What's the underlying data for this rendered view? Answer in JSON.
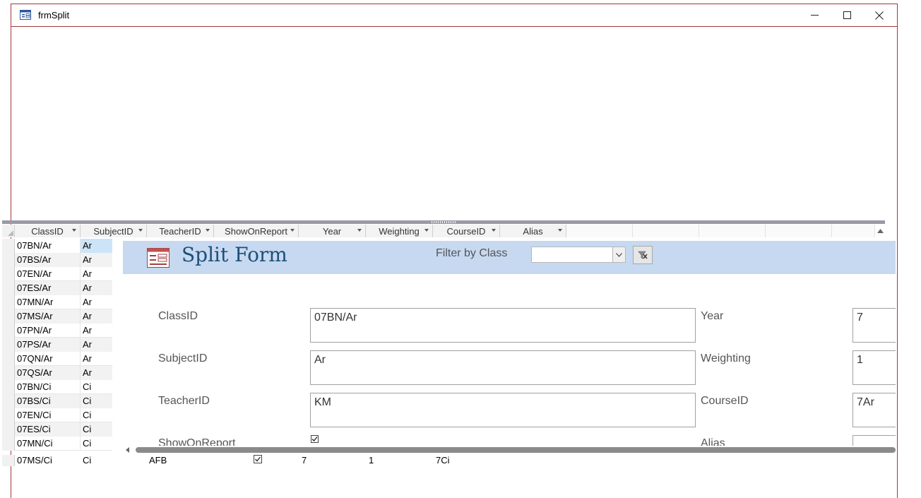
{
  "window": {
    "title": "frmSplit",
    "minimize_glyph": "—",
    "maximize_glyph": "☐",
    "close_glyph": "✕"
  },
  "datasheet": {
    "columns": [
      "ClassID",
      "SubjectID",
      "TeacherID",
      "ShowOnReport",
      "Year",
      "Weighting",
      "CourseID",
      "Alias"
    ],
    "rows": [
      {
        "ClassID": "07BN/Ar",
        "SubjectID": "Ar"
      },
      {
        "ClassID": "07BS/Ar",
        "SubjectID": "Ar"
      },
      {
        "ClassID": "07EN/Ar",
        "SubjectID": "Ar"
      },
      {
        "ClassID": "07ES/Ar",
        "SubjectID": "Ar"
      },
      {
        "ClassID": "07MN/Ar",
        "SubjectID": "Ar"
      },
      {
        "ClassID": "07MS/Ar",
        "SubjectID": "Ar"
      },
      {
        "ClassID": "07PN/Ar",
        "SubjectID": "Ar"
      },
      {
        "ClassID": "07PS/Ar",
        "SubjectID": "Ar"
      },
      {
        "ClassID": "07QN/Ar",
        "SubjectID": "Ar"
      },
      {
        "ClassID": "07QS/Ar",
        "SubjectID": "Ar"
      },
      {
        "ClassID": "07BN/Ci",
        "SubjectID": "Ci"
      },
      {
        "ClassID": "07BS/Ci",
        "SubjectID": "Ci"
      },
      {
        "ClassID": "07EN/Ci",
        "SubjectID": "Ci"
      },
      {
        "ClassID": "07ES/Ci",
        "SubjectID": "Ci"
      },
      {
        "ClassID": "07MN/Ci",
        "SubjectID": "Ci"
      }
    ],
    "partial_row": {
      "ClassID": "07MS/Ci",
      "SubjectID": "Ci",
      "TeacherID": "AFB",
      "Year": "7",
      "Weighting": "1",
      "CourseID": "7Ci"
    }
  },
  "form": {
    "title": "Split Form",
    "filter_label": "Filter by Class",
    "filter_value": "",
    "fields": {
      "classid_label": "ClassID",
      "classid_value": "07BN/Ar",
      "subjectid_label": "SubjectID",
      "subjectid_value": "Ar",
      "teacherid_label": "TeacherID",
      "teacherid_value": "KM",
      "showonreport_label": "ShowOnReport",
      "year_label": "Year",
      "year_value": "7",
      "weighting_label": "Weighting",
      "weighting_value": "1",
      "courseid_label": "CourseID",
      "courseid_value": "7Ar",
      "alias_label": "Alias"
    }
  },
  "colors": {
    "window_border": "#a4373a",
    "form_header": "#c6d9f0",
    "title_text": "#1f4e79",
    "selection": "#cce4f7"
  }
}
